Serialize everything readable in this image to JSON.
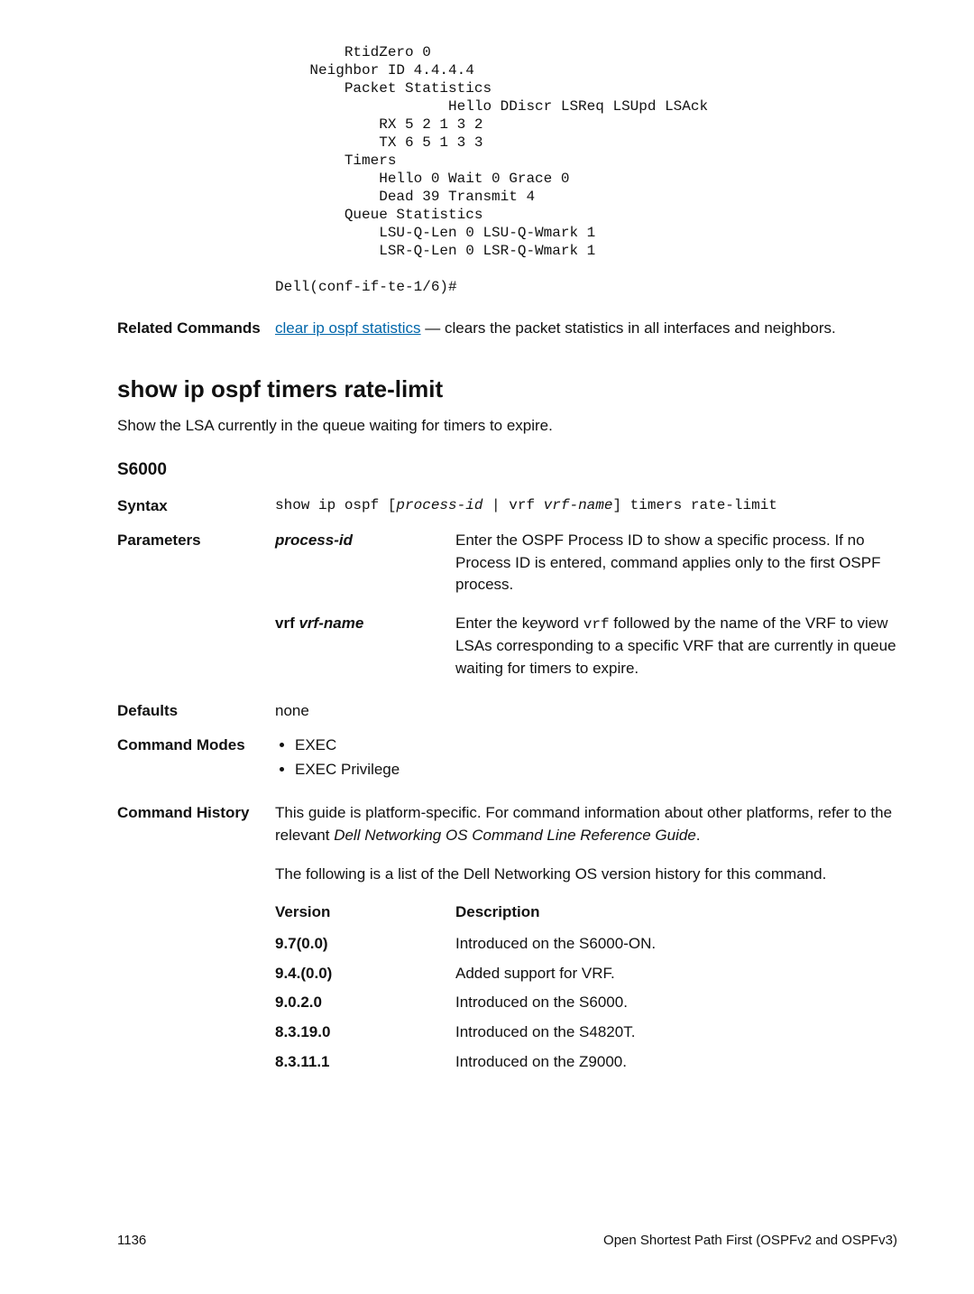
{
  "code_block": "        RtidZero 0\n    Neighbor ID 4.4.4.4\n        Packet Statistics\n                    Hello DDiscr LSReq LSUpd LSAck\n            RX 5 2 1 3 2\n            TX 6 5 1 3 3\n        Timers\n            Hello 0 Wait 0 Grace 0\n            Dead 39 Transmit 4\n        Queue Statistics\n            LSU-Q-Len 0 LSU-Q-Wmark 1\n            LSR-Q-Len 0 LSR-Q-Wmark 1\n\nDell(conf-if-te-1/6)#",
  "related": {
    "label": "Related Commands",
    "link_text": "clear ip ospf statistics",
    "link_suffix": " — clears the packet statistics in all interfaces and neighbors."
  },
  "section": {
    "title": "show ip ospf timers rate-limit",
    "subtitle": "Show the LSA currently in the queue waiting for timers to expire.",
    "model": "S6000"
  },
  "syntax": {
    "label": "Syntax",
    "text_pre": "show ip ospf [",
    "proc": "process-id",
    "text_mid1": " | vrf ",
    "vrf": "vrf-name",
    "text_post": "] timers rate-limit"
  },
  "parameters": {
    "label": "Parameters",
    "rows": [
      {
        "key": "process-id",
        "desc": "Enter the OSPF Process ID to show a specific process. If no Process ID is entered, command applies only to the first OSPF process."
      },
      {
        "key_prefix": "vrf ",
        "key_var": "vrf-name",
        "desc_pre": "Enter the keyword ",
        "desc_code": "vrf",
        "desc_post": " followed by the name of the VRF to view LSAs corresponding to a specific VRF that are currently in queue waiting for timers to expire."
      }
    ]
  },
  "defaults": {
    "label": "Defaults",
    "value": "none"
  },
  "modes": {
    "label": "Command Modes",
    "items": [
      "EXEC",
      "EXEC Privilege"
    ]
  },
  "history": {
    "label": "Command History",
    "para1_a": "This guide is platform-specific. For command information about other platforms, refer to the relevant ",
    "para1_italic": "Dell Networking OS Command Line Reference Guide",
    "para1_b": ".",
    "para2": "The following is a list of the Dell Networking OS version history for this command.",
    "header_ver": "Version",
    "header_desc": "Description",
    "rows": [
      {
        "ver": "9.7(0.0)",
        "desc": "Introduced on the S6000-ON."
      },
      {
        "ver": "9.4.(0.0)",
        "desc": "Added support for VRF."
      },
      {
        "ver": "9.0.2.0",
        "desc": "Introduced on the S6000."
      },
      {
        "ver": "8.3.19.0",
        "desc": "Introduced on the S4820T."
      },
      {
        "ver": "8.3.11.1",
        "desc": "Introduced on the Z9000."
      }
    ]
  },
  "footer": {
    "page": "1136",
    "chapter": "Open Shortest Path First (OSPFv2 and OSPFv3)"
  }
}
